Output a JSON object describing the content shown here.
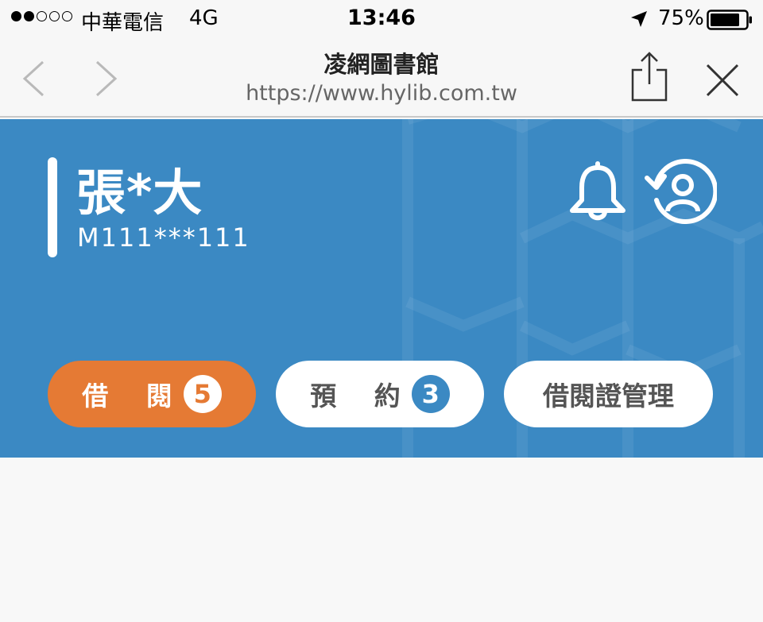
{
  "status_bar": {
    "carrier": "中華電信",
    "network": "4G",
    "time": "13:46",
    "battery": "75%",
    "signal_strength": 2,
    "signal_max": 5
  },
  "browser": {
    "title": "凌網圖書館",
    "url": "https://www.hylib.com.tw"
  },
  "user": {
    "name": "張*大",
    "id": "M111***111"
  },
  "tabs": {
    "borrow_label": "借 閱",
    "borrow_count": "5",
    "reserve_label": "預 約",
    "reserve_count": "3",
    "card_label": "借閱證管理"
  },
  "colors": {
    "header_blue": "#3b89c3",
    "accent_orange": "#e57a34"
  },
  "icons": {
    "notifications": "bell-icon",
    "switch_account": "switch-user-icon",
    "share": "share-icon",
    "close": "close-icon"
  }
}
